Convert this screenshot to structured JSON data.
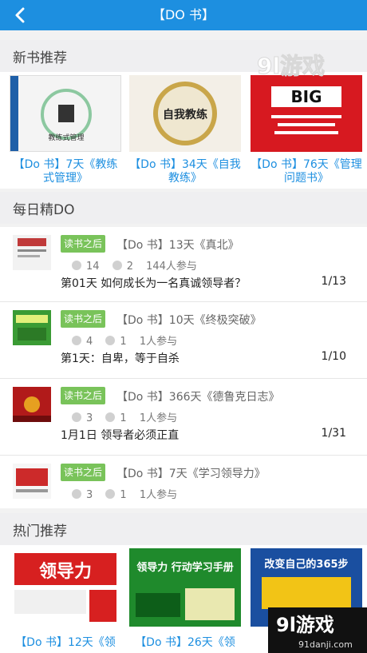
{
  "header": {
    "title": "【DO 书】",
    "back_icon": "chevron-left-icon"
  },
  "sections": {
    "new_books": "新书推荐",
    "daily": "每日精DO",
    "hot": "热门推荐"
  },
  "new_books": [
    {
      "caption": "【Do 书】7天《教练式管理》",
      "cover_text": "教练式管理"
    },
    {
      "caption": "【Do 书】34天《自我教练》",
      "cover_text": "自我教练"
    },
    {
      "caption": "【Do 书】76天《管理问题书》",
      "cover_text": "BIG"
    }
  ],
  "daily": [
    {
      "tag": "读书之后",
      "title": "【Do 书】13天《真北》",
      "likes": "14",
      "comments": "2",
      "participants": "144人参与",
      "task": "第01天 如何成长为一名真诚领导者？",
      "progress": "1/13"
    },
    {
      "tag": "读书之后",
      "title": "【Do 书】10天《终极突破》",
      "likes": "4",
      "comments": "1",
      "participants": "1人参与",
      "task": "第1天：自卑，等于自杀",
      "progress": "1/10"
    },
    {
      "tag": "读书之后",
      "title": "【Do 书】366天《德鲁克日志》",
      "likes": "3",
      "comments": "1",
      "participants": "1人参与",
      "task": "1月1日 领导者必须正直",
      "progress": "1/31"
    },
    {
      "tag": "读书之后",
      "title": "【Do 书】7天《学习领导力》",
      "likes": "3",
      "comments": "1",
      "participants": "1人参与",
      "task": "",
      "progress": ""
    }
  ],
  "hot_books": [
    {
      "caption": "【Do 书】12天《领",
      "cover_text": "领导力"
    },
    {
      "caption": "【Do 书】26天《领",
      "cover_text": "领导力 行动学习手册"
    },
    {
      "caption": "",
      "cover_text": "改变自己的365步"
    }
  ],
  "watermark": {
    "brand": "9l游戏",
    "site": "91danji.com"
  },
  "colors": {
    "accent": "#1d8fe0",
    "tag_green": "#79c35a"
  }
}
